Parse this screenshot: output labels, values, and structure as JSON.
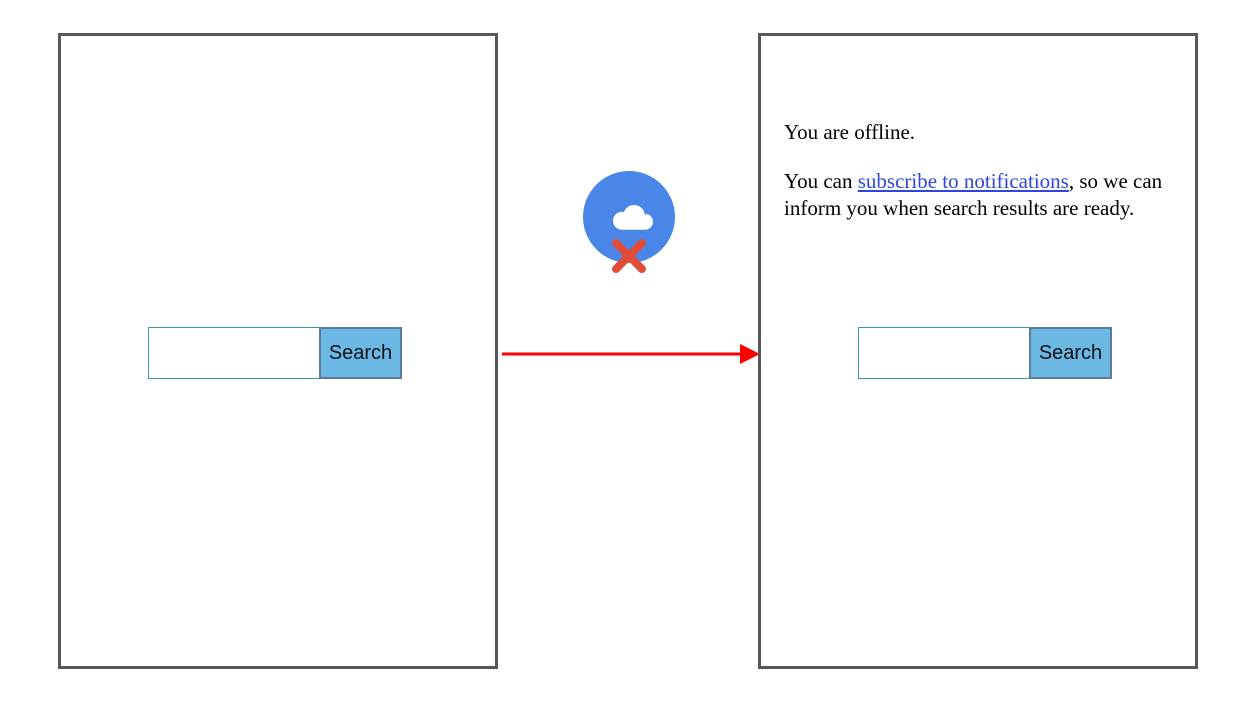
{
  "left_panel": {
    "search": {
      "value": "",
      "button_label": "Search"
    }
  },
  "right_panel": {
    "message": {
      "line1": "You are offline.",
      "line2_pre": "You can ",
      "link_text": "subscribe to notifications",
      "line2_post": ", so we can inform you when search results are ready."
    },
    "search": {
      "value": "",
      "button_label": "Search"
    }
  },
  "icons": {
    "offline_cloud": "cloud-offline-icon",
    "x_mark": "x-icon",
    "arrow": "arrow-right-icon"
  },
  "colors": {
    "panel_border": "#55575b",
    "input_border": "#2f9e9a",
    "button_bg": "#6bb8e5",
    "button_border": "#5a7c96",
    "cloud_bg": "#4a86e8",
    "x_color": "#e14c37",
    "arrow_color": "#ff0000",
    "link_color": "#2d46e2"
  }
}
